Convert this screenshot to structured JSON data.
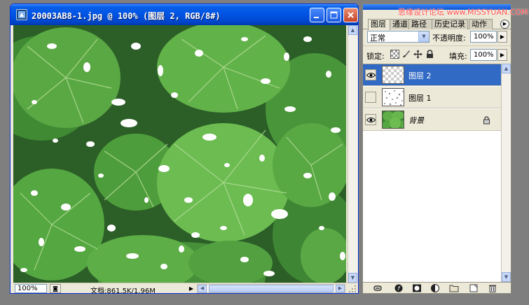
{
  "document_window": {
    "title": "20003AB8-1.jpg @ 100% (图层 2, RGB/8#)",
    "zoom": "100%",
    "doc_info": "文档:861.5K/1.96M"
  },
  "layers_panel": {
    "watermark": "思缘设计论坛 www.MISSYUAN.COM",
    "tabs": [
      "图层",
      "通道",
      "路径",
      "历史记录",
      "动作"
    ],
    "active_tab": 0,
    "blend_mode": "正常",
    "opacity_label": "不透明度:",
    "opacity_value": "100%",
    "lock_label": "锁定:",
    "fill_label": "填充:",
    "fill_value": "100%",
    "layers": [
      {
        "name": "图层 2",
        "visible": true,
        "selected": true,
        "locked": false
      },
      {
        "name": "图层 1",
        "visible": false,
        "selected": false,
        "locked": false
      },
      {
        "name": "背景",
        "visible": true,
        "selected": false,
        "locked": true
      }
    ]
  },
  "colors": {
    "titlebar": "#0055e5",
    "selection": "#316ac5",
    "panel_bg": "#ece9d8",
    "desktop": "#7f7f7f",
    "leaf_green": "#58b23e"
  }
}
